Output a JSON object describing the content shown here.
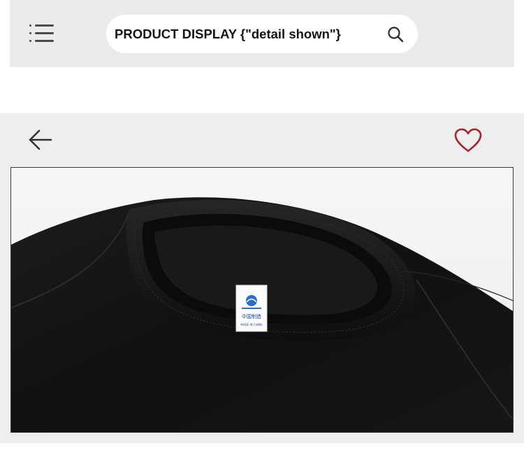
{
  "header": {
    "search_value": "PRODUCT DISPLAY {\"detail shown\"}",
    "menu_icon": "hamburger-menu-icon",
    "search_icon": "search-icon"
  },
  "product": {
    "back_icon": "arrow-left-icon",
    "favorite_icon": "heart-outline-icon",
    "image_subject": "black crew-neck sweatshirt collar close-up with white neck label",
    "label_text_line1": "中国制造",
    "label_text_line2": "MADE IN CHINA"
  },
  "colors": {
    "header_bg": "#ebebeb",
    "section_bg": "#eeeeee",
    "heart": "#a8242a",
    "garment": "#141414"
  }
}
